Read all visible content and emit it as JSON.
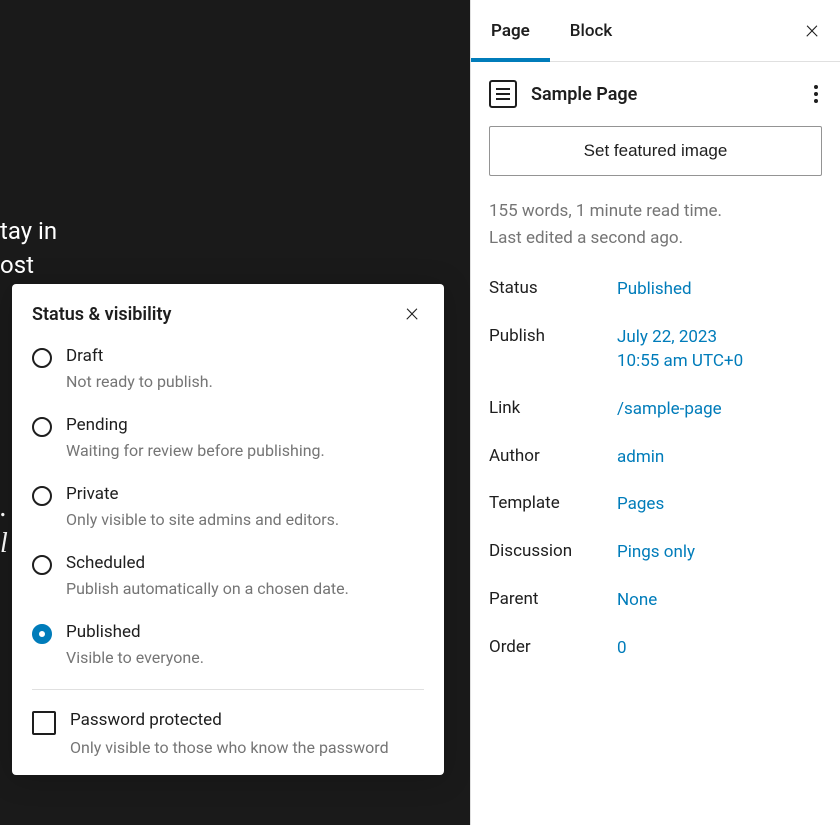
{
  "editor_bg": {
    "line1": "tay in",
    "line2": "ost",
    "italic1": ".",
    "italic2": "l"
  },
  "popover": {
    "title": "Status & visibility",
    "options": [
      {
        "label": "Draft",
        "desc": "Not ready to publish."
      },
      {
        "label": "Pending",
        "desc": "Waiting for review before publishing."
      },
      {
        "label": "Private",
        "desc": "Only visible to site admins and editors."
      },
      {
        "label": "Scheduled",
        "desc": "Publish automatically on a chosen date."
      },
      {
        "label": "Published",
        "desc": "Visible to everyone."
      }
    ],
    "selected_index": 4,
    "checkbox": {
      "label": "Password protected",
      "desc": "Only visible to those who know the password"
    }
  },
  "sidebar": {
    "tabs": [
      "Page",
      "Block"
    ],
    "active_tab": 0,
    "page_title": "Sample Page",
    "featured_button": "Set featured image",
    "meta_words": "155 words, 1 minute read time.",
    "meta_edited": "Last edited a second ago.",
    "summary": {
      "status": {
        "label": "Status",
        "value": "Published"
      },
      "publish": {
        "label": "Publish",
        "value": "July 22, 2023\n10:55 am UTC+0"
      },
      "link": {
        "label": "Link",
        "value": "/sample-page"
      },
      "author": {
        "label": "Author",
        "value": "admin"
      },
      "template": {
        "label": "Template",
        "value": "Pages"
      },
      "discussion": {
        "label": "Discussion",
        "value": "Pings only"
      },
      "parent": {
        "label": "Parent",
        "value": "None"
      },
      "order": {
        "label": "Order",
        "value": "0"
      }
    }
  }
}
